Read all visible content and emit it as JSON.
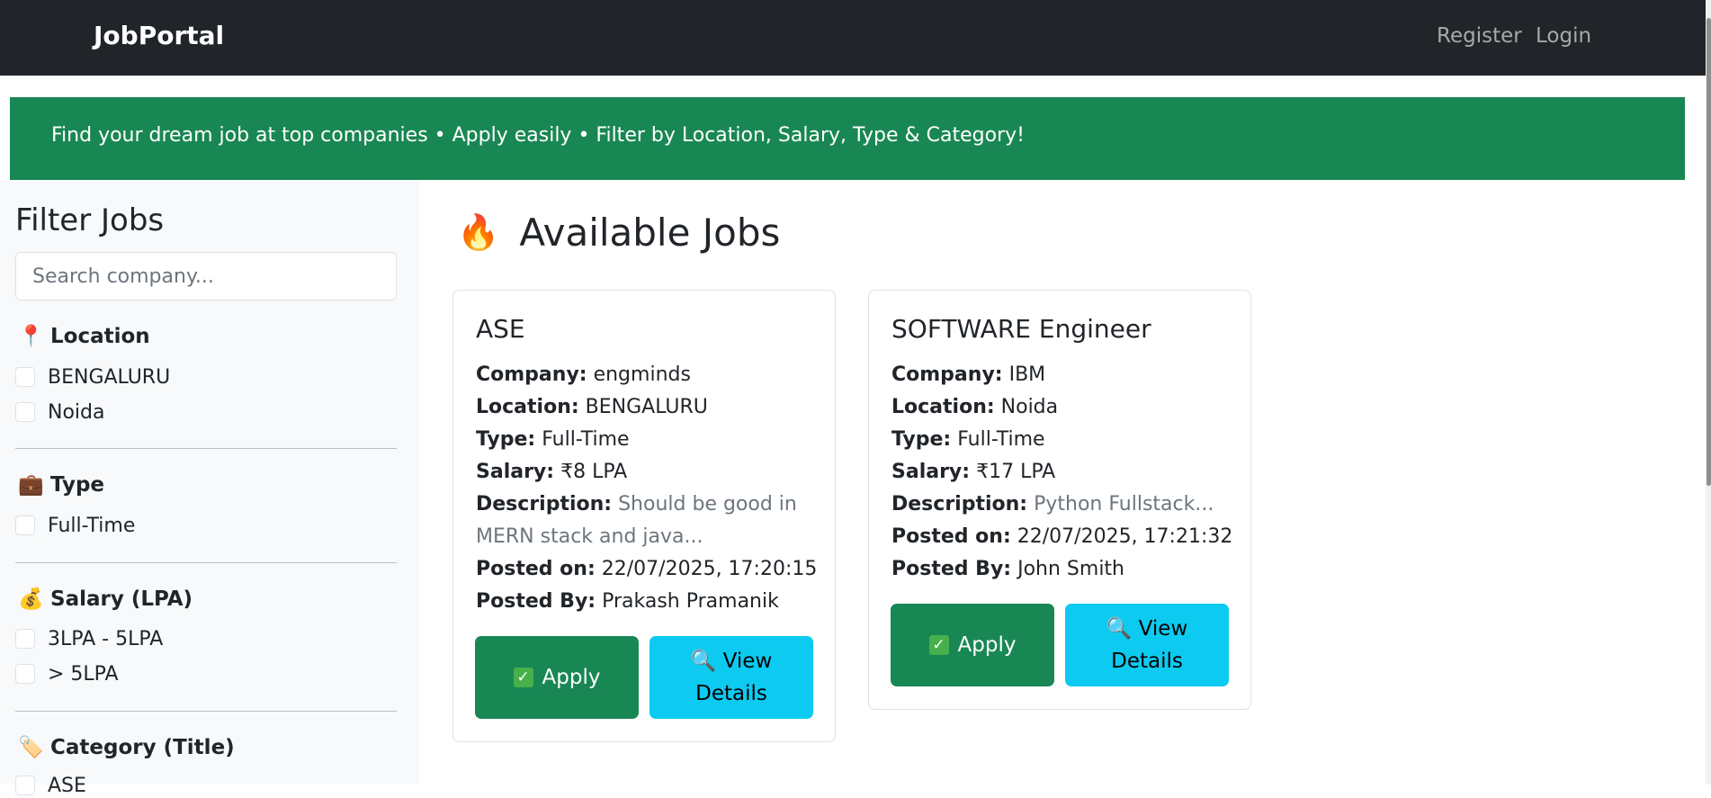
{
  "navbar": {
    "brand": "JobPortal",
    "register": "Register",
    "login": "Login"
  },
  "banner": {
    "text": "Find your dream job at top companies • Apply easily • Filter by Location, Salary, Type & Category!"
  },
  "sidebar": {
    "title": "Filter Jobs",
    "search_placeholder": "Search company...",
    "location": {
      "label": "Location",
      "icon": "pin-icon",
      "options": [
        "BENGALURU",
        "Noida"
      ]
    },
    "type": {
      "label": "Type",
      "icon": "briefcase-icon",
      "options": [
        "Full-Time"
      ]
    },
    "salary": {
      "label": "Salary (LPA)",
      "icon": "money-bag-icon",
      "options": [
        "3LPA - 5LPA",
        "> 5LPA"
      ]
    },
    "category": {
      "label": "Category (Title)",
      "icon": "tag-icon",
      "options": [
        "ASE"
      ]
    }
  },
  "main": {
    "title": "Available Jobs",
    "title_icon": "fire-icon",
    "jobs": [
      {
        "title": "ASE",
        "company_label": "Company:",
        "company": "engminds",
        "location_label": "Location:",
        "location": "BENGALURU",
        "type_label": "Type:",
        "type": "Full-Time",
        "salary_label": "Salary:",
        "salary": "₹8 LPA",
        "description_label": "Description:",
        "description": "Should be good in MERN stack and java...",
        "posted_on_label": "Posted on:",
        "posted_on": "22/07/2025, 17:20:15",
        "posted_by_label": "Posted By:",
        "posted_by": "Prakash Pramanik",
        "apply_label": "Apply",
        "view_label": "View Details"
      },
      {
        "title": "SOFTWARE Engineer",
        "company_label": "Company:",
        "company": "IBM",
        "location_label": "Location:",
        "location": "Noida",
        "type_label": "Type:",
        "type": "Full-Time",
        "salary_label": "Salary:",
        "salary": "₹17 LPA",
        "description_label": "Description:",
        "description": "Python Fullstack...",
        "posted_on_label": "Posted on:",
        "posted_on": "22/07/2025, 17:21:32",
        "posted_by_label": "Posted By:",
        "posted_by": "John Smith",
        "apply_label": "Apply",
        "view_label": "View Details"
      }
    ]
  },
  "colors": {
    "navbar": "#212529",
    "banner": "#198754",
    "apply": "#198754",
    "view": "#0dcaf0"
  }
}
